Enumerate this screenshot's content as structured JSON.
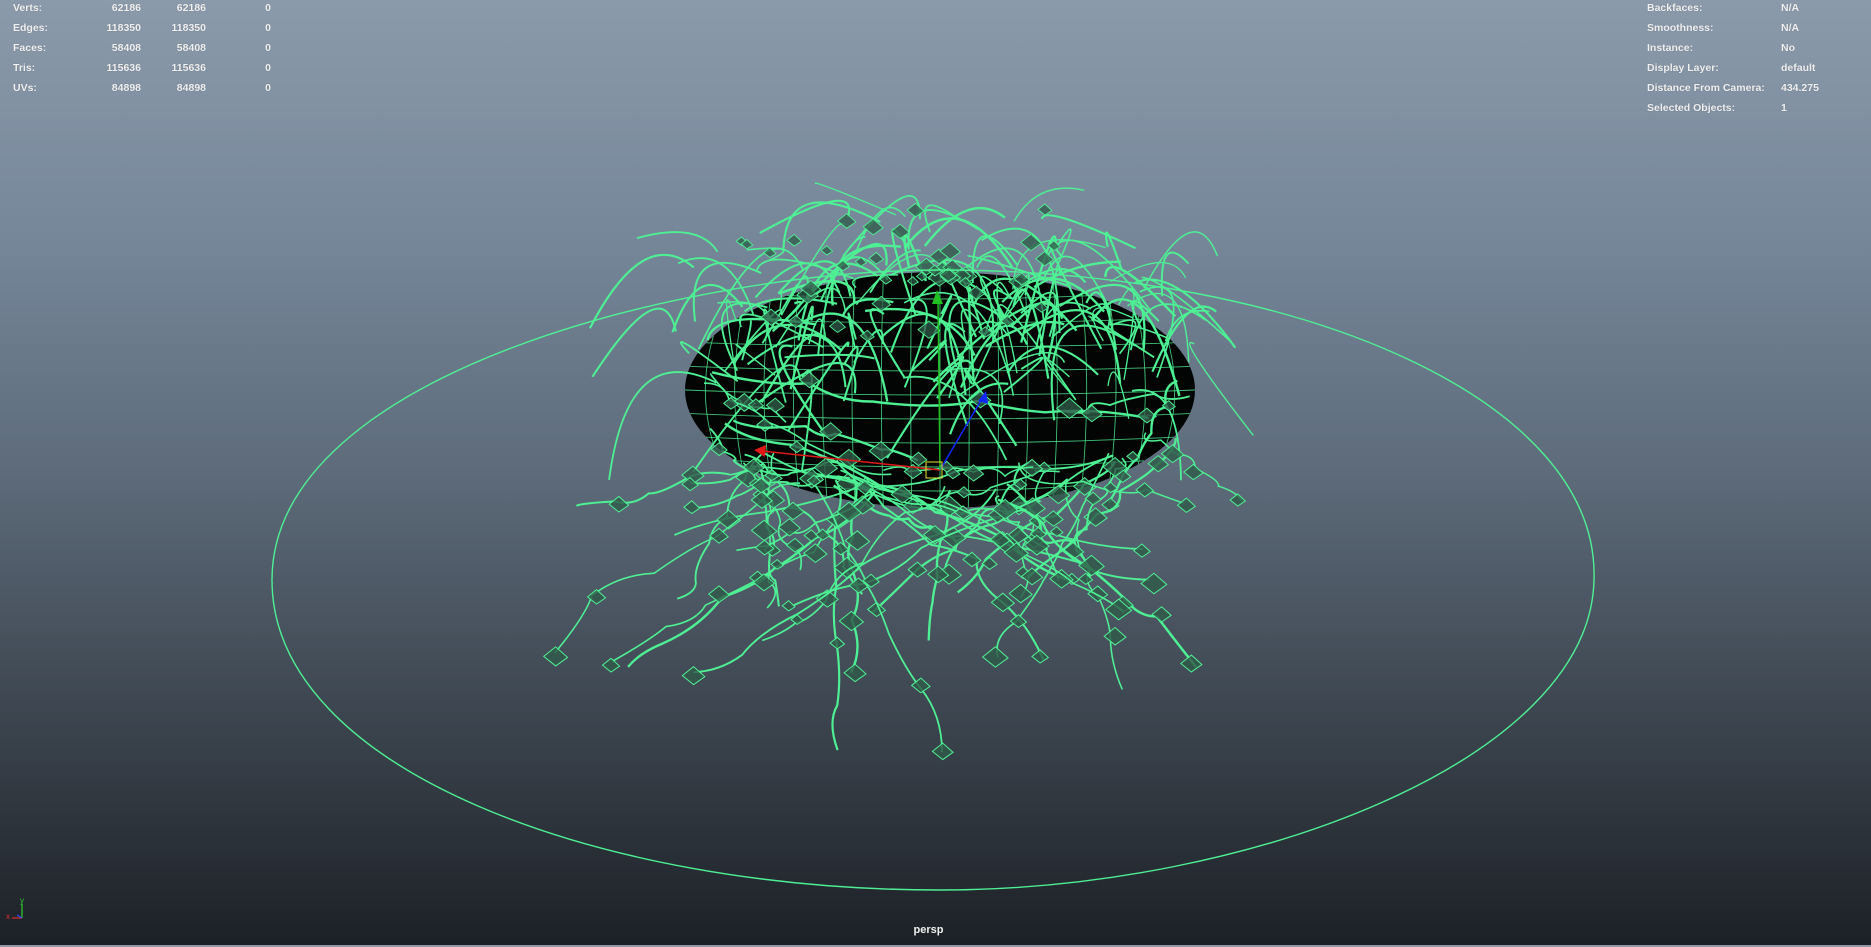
{
  "viewport": {
    "camera_label": "persp",
    "wire_color": "#4ef094",
    "background_top": "#8b9aaa",
    "background_bottom": "#1c2026"
  },
  "stats": {
    "rows": [
      {
        "label": "Verts:",
        "c1": "62186",
        "c2": "62186",
        "c3": "0"
      },
      {
        "label": "Edges:",
        "c1": "118350",
        "c2": "118350",
        "c3": "0"
      },
      {
        "label": "Faces:",
        "c1": "58408",
        "c2": "58408",
        "c3": "0"
      },
      {
        "label": "Tris:",
        "c1": "115636",
        "c2": "115636",
        "c3": "0"
      },
      {
        "label": "UVs:",
        "c1": "84898",
        "c2": "84898",
        "c3": "0"
      }
    ]
  },
  "object_info": {
    "rows": [
      {
        "label": "Backfaces:",
        "value": "N/A"
      },
      {
        "label": "Smoothness:",
        "value": "N/A"
      },
      {
        "label": "Instance:",
        "value": "No"
      },
      {
        "label": "Display Layer:",
        "value": "default"
      },
      {
        "label": "Distance From Camera:",
        "value": "434.275"
      },
      {
        "label": "Selected Objects:",
        "value": "1"
      }
    ]
  },
  "axis_gizmo": {
    "x_label": "x",
    "y_label": "y",
    "x_color": "#e03030",
    "y_color": "#30d030",
    "z_color": "#3050ff"
  },
  "manipulator": {
    "x_color": "#e01818",
    "y_color": "#20c020",
    "z_color": "#1028ff"
  }
}
